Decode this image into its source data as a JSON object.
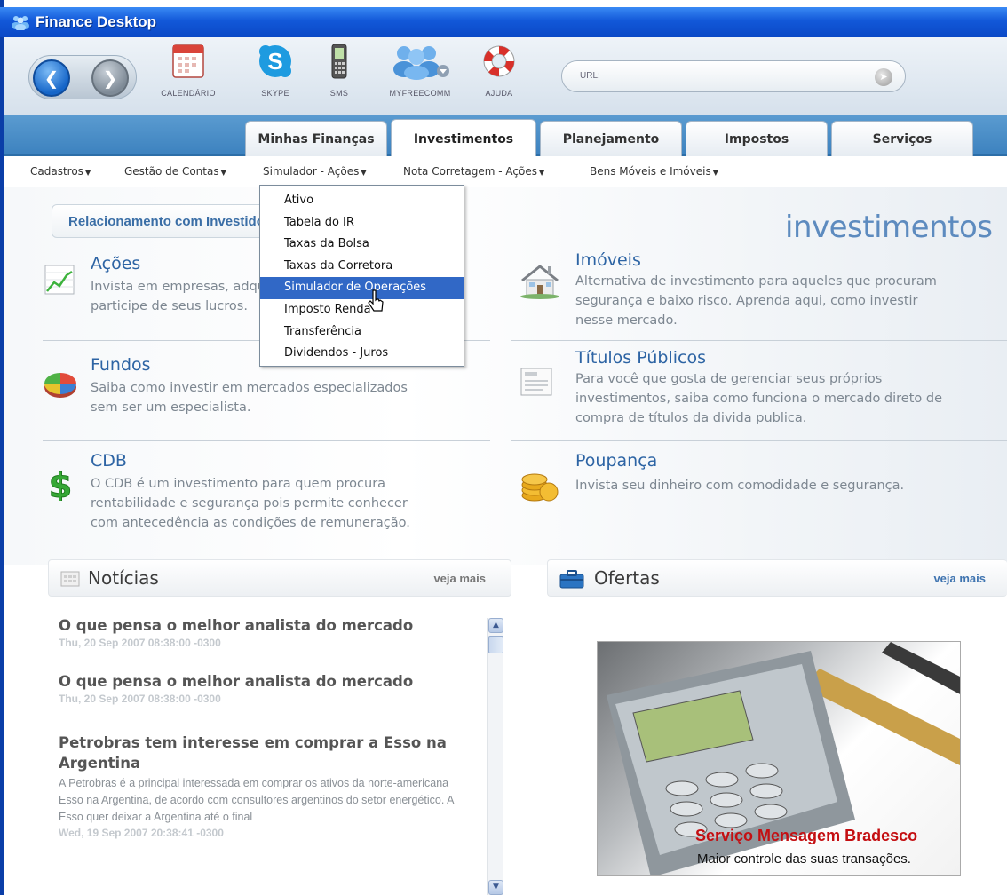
{
  "window": {
    "title": "Finance Desktop"
  },
  "toolbar": {
    "items": [
      {
        "label": "CALENDÁRIO",
        "icon": "calendar-icon"
      },
      {
        "label": "SKYPE",
        "icon": "skype-icon"
      },
      {
        "label": "SMS",
        "icon": "mobile-phone-icon"
      },
      {
        "label": "MYFREECOMM",
        "icon": "people-icon"
      },
      {
        "label": "AJUDA",
        "icon": "lifebuoy-icon"
      }
    ],
    "url_label": "URL:"
  },
  "tabs": [
    {
      "label": "Minhas Finanças",
      "active": false
    },
    {
      "label": "Investimentos",
      "active": true
    },
    {
      "label": "Planejamento",
      "active": false
    },
    {
      "label": "Impostos",
      "active": false
    },
    {
      "label": "Serviços",
      "active": false
    }
  ],
  "menus": [
    {
      "label": "Cadastros"
    },
    {
      "label": "Gestão de Contas"
    },
    {
      "label": "Simulador - Ações"
    },
    {
      "label": "Nota Corretagem - Ações"
    },
    {
      "label": "Bens Móveis e Imóveis"
    }
  ],
  "dropdown": {
    "items": [
      "Ativo",
      "Tabela do IR",
      "Taxas da Bolsa",
      "Taxas da Corretora",
      "Simulador de Operações",
      "Imposto Renda",
      "Transferência",
      "Dividendos - Juros"
    ],
    "highlighted": "Simulador de Operações"
  },
  "content": {
    "relationship_label": "Relacionamento com Investidores",
    "section_title": "investimentos",
    "investments": [
      {
        "title": "Ações",
        "desc_lines": [
          "Invista em empresas, adquira participação acionária e",
          "participe de seus lucros."
        ]
      },
      {
        "title": "Imóveis",
        "desc_lines": [
          "Alternativa de investimento para aqueles que procuram",
          "segurança e baixo risco. Aprenda aqui, como investir",
          "nesse mercado."
        ]
      },
      {
        "title": "Fundos",
        "desc_lines": [
          "Saiba como investir em mercados especializados",
          "sem ser um especialista."
        ]
      },
      {
        "title": "Títulos Públicos",
        "desc_lines": [
          "Para você que gosta de gerenciar seus próprios",
          "investimentos, saiba como funciona o mercado direto de",
          "compra de títulos da divida publica."
        ]
      },
      {
        "title": "CDB",
        "desc_lines": [
          "O CDB é um investimento para quem procura",
          "rentabilidade e segurança pois permite conhecer",
          "com antecedência as condições de remuneração."
        ]
      },
      {
        "title": "Poupança",
        "desc_lines": [
          "Invista seu dinheiro com comodidade e segurança."
        ]
      }
    ]
  },
  "news_panel": {
    "title": "Notícias",
    "more": "veja mais",
    "items": [
      {
        "title": "O que pensa o melhor analista do mercado",
        "date": "Thu, 20 Sep 2007 08:38:00 -0300",
        "body": ""
      },
      {
        "title": "O que pensa o melhor analista do mercado",
        "date": "Thu, 20 Sep 2007 08:38:00 -0300",
        "body": ""
      },
      {
        "title": "Petrobras tem interesse em comprar a Esso na Argentina",
        "date": "Wed, 19 Sep 2007 20:38:41 -0300",
        "body": "A Petrobras é a principal interessada em comprar os ativos da norte-americana Esso na Argentina, de acordo com consultores argentinos do setor energético. A Esso quer deixar a Argentina até o final"
      }
    ]
  },
  "offers_panel": {
    "title": "Ofertas",
    "more": "veja mais",
    "promo_line1": "Serviço  Mensagem Bradesco",
    "promo_line2": "Maior controle das suas transações."
  },
  "colors": {
    "titlebar": "#1258d8",
    "tab_bar": "#4a8cc8",
    "link_title": "#2d64a4",
    "highlight": "#3168c6",
    "promo_red": "#c40f12"
  }
}
